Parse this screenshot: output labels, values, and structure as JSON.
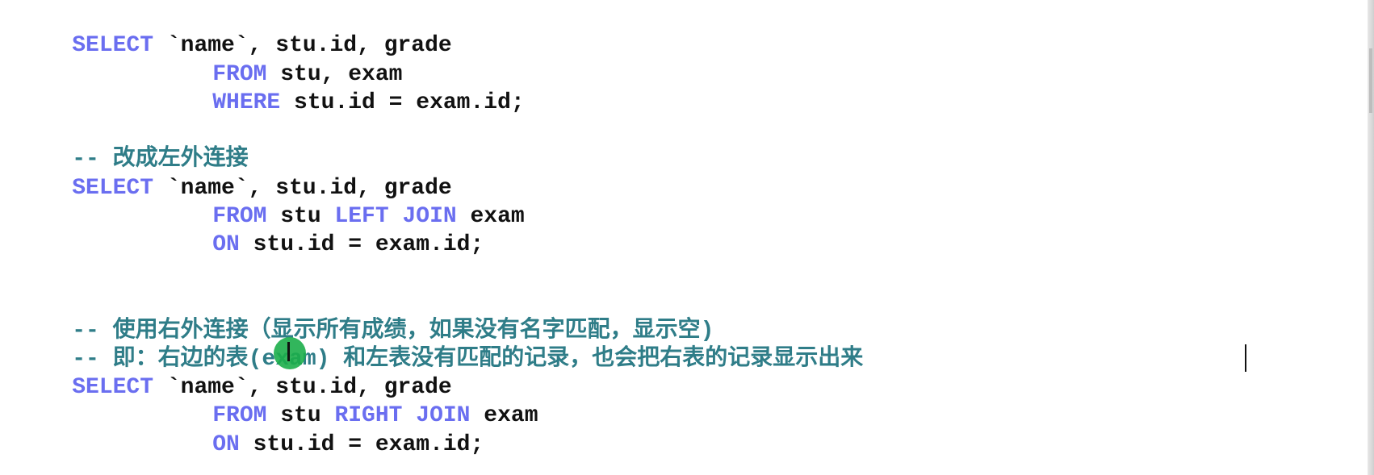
{
  "code": {
    "block1": {
      "select_kw": "SELECT",
      "select_rest": " `name`, stu.id, grade",
      "from_kw": "FROM",
      "from_rest": " stu, exam",
      "where_kw": "WHERE",
      "where_rest": " stu.id = exam.id;"
    },
    "block2": {
      "comment": "-- 改成左外连接",
      "select_kw": "SELECT",
      "select_rest": " `name`, stu.id, grade",
      "from_kw": "FROM",
      "from_rest_a": " stu ",
      "join_kw": "LEFT JOIN",
      "from_rest_b": " exam",
      "on_kw": "ON",
      "on_rest": " stu.id = exam.id;"
    },
    "block3": {
      "comment1": "-- 使用右外连接（显示所有成绩，如果没有名字匹配，显示空)",
      "comment2": "-- 即：右边的表(exam) 和左表没有匹配的记录，也会把右表的记录显示出来",
      "select_kw": "SELECT",
      "select_rest": " `name`, stu.id, grade",
      "from_kw": "FROM",
      "from_rest_a": " stu ",
      "join_kw": "RIGHT JOIN",
      "from_rest_b": " exam",
      "on_kw": "ON",
      "on_rest": " stu.id = exam.id;"
    }
  },
  "colors": {
    "keyword": "#6a6ef0",
    "comment": "#2f7d88",
    "text": "#111111",
    "pointer": "#1cae4a"
  }
}
